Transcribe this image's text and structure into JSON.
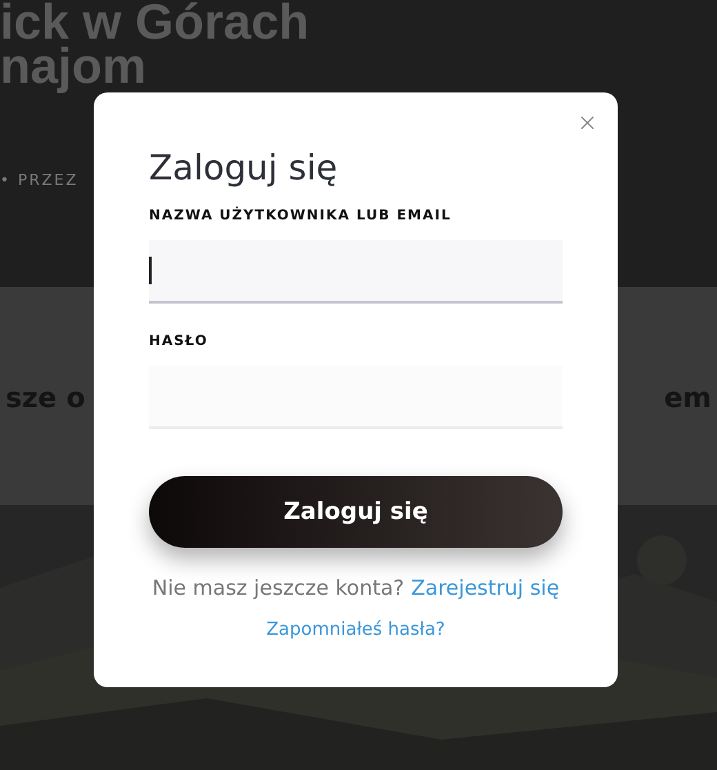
{
  "background": {
    "title_lines": [
      "ick w Górach",
      "najom"
    ],
    "byline": "• PRZEZ",
    "band_left": "sze o",
    "band_right": "em"
  },
  "modal": {
    "title": "Zaloguj się",
    "fields": [
      {
        "label": "NAZWA UŻYTKOWNIKA LUB EMAIL",
        "focused": true
      },
      {
        "label": "HASŁO",
        "focused": false
      }
    ],
    "submit": "Zaloguj się",
    "signup": {
      "prompt": "Nie masz jeszcze konta?",
      "link": "Zarejestruj się"
    },
    "forgot": "Zapomniałeś hasła?"
  }
}
